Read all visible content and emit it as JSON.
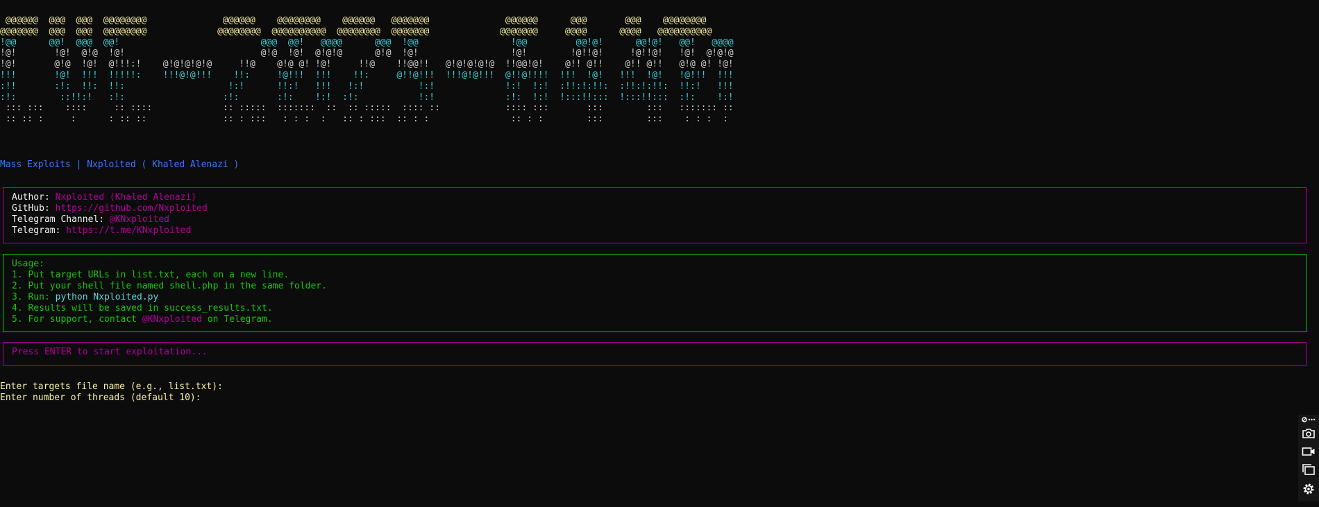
{
  "banner": {
    "rows": [
      [
        {
          "t": " @@@@@@  @@@  @@@  @@@@@@@@              @@@@@@    @@@@@@@@    @@@@@@   @@@@@@@              @@@@@@      @@@       @@@    @@@@@@@@",
          "c": "y"
        }
      ],
      [
        {
          "t": "@@@@@@@  @@@  @@@  @@@@@@@@             @@@@@@@@  @@@@@@@@@@  @@@@@@@@  @@@@@@@             @@@@@@@     @@@@      @@@@   @@@@@@@@@@",
          "c": "y"
        }
      ],
      [
        {
          "t": "!@@      ",
          "c": "c"
        },
        {
          "t": "@@!  @@@  @@!                          @@@  @@!   @@@@      @@@  !@@                 !@@         @@!@!      @@!@!   @@!   @@@@",
          "c": "c"
        }
      ],
      [
        {
          "t": "!@!       !@!  @!@  !@!                         @!@  !@!  @!@!@      @!@  !@!                 !@!        !@!!@!     !@!!@!   !@!  @!@!@",
          "c": "w"
        }
      ],
      [
        {
          "t": "!@!       @!@  !@!  @!!!:!    @!@!@!@!@     !!@    @!@ @! !@!     !!@    !!@@!!   @!@!@!@!@  !!@@!@!    @!! @!!    @!! @!!   @!@ @! !@!",
          "c": "w"
        }
      ],
      [
        {
          "t": "!!!       !@!  !!!  !!!!!:    !!!@!@!!!    !!:     !@!!!  !!!    !!:     @!!@!!!  !!!@!@!!!  @!!@!!!!  !!!  !@!   !!!  !@!   !@!!!  !!!",
          "c": "c"
        }
      ],
      [
        {
          "t": ":!!       :!:  !!:  !!:                   !:!      !!:!   !!!   !:!          !:!             !:!  !:!  :!!:!:!!:  :!!:!:!!:  !!:!   !!!",
          "c": "c"
        }
      ],
      [
        {
          "t": ":!:        ::!!:!   :!:                  :!:       :!:    !:!  :!:           !:!             :!:  !:!  !:::!!:::  !:::!!:::  :!:    !:!",
          "c": "c"
        }
      ],
      [
        {
          "t": " ::: :::    ::::     :: ::::             :: :::::  :::::::  ::  :: :::::  :::: ::            :::: :::       :::        :::   ::::::: ::",
          "c": "w"
        }
      ],
      [
        {
          "t": " :: :: :     :      : :: ::              :: : :::   : : :  :   :: : :::  :: : :               :: : :        :::        :::    : : :  :",
          "c": "w"
        }
      ]
    ]
  },
  "subtitle": "Mass Exploits | Nxploited ( Khaled Alenazi )",
  "info": {
    "author_label": "Author: ",
    "author_value": "Nxploited (Khaled Alenazi)",
    "github_label": "GitHub: ",
    "github_value": "https://github.com/Nxploited",
    "channel_label": "Telegram Channel: ",
    "channel_value": "@KNxploited",
    "telegram_label": "Telegram: ",
    "telegram_value": "https://t.me/KNxploited"
  },
  "usage": {
    "title": "Usage:",
    "step1": "1. Put target URLs in list.txt, each on a new line.",
    "step2": "2. Put your shell file named shell.php in the same folder.",
    "step3_prefix": "3. Run: ",
    "step3_cmd": "python Nxploited.py",
    "step4": "4. Results will be saved in success_results.txt.",
    "step5_prefix": "5. For support, contact ",
    "step5_handle": "@KNxploited",
    "step5_suffix": " on Telegram."
  },
  "prompt": "Press ENTER to start exploitation...",
  "inputs": {
    "targets_prompt": "Enter targets file name (e.g., list.txt):",
    "threads_prompt": "Enter number of threads (default 10):"
  },
  "toolbar": {
    "icons": [
      "pin-more-icon",
      "camera-icon",
      "video-icon",
      "copy-icon",
      "gear-icon"
    ]
  },
  "colors": {
    "background": "#0c0c0c",
    "magenta": "#b4009e",
    "green": "#16c60c",
    "blue": "#3b78ff",
    "yellow": "#f9f1a5",
    "cyan": "#3fd0d8"
  }
}
